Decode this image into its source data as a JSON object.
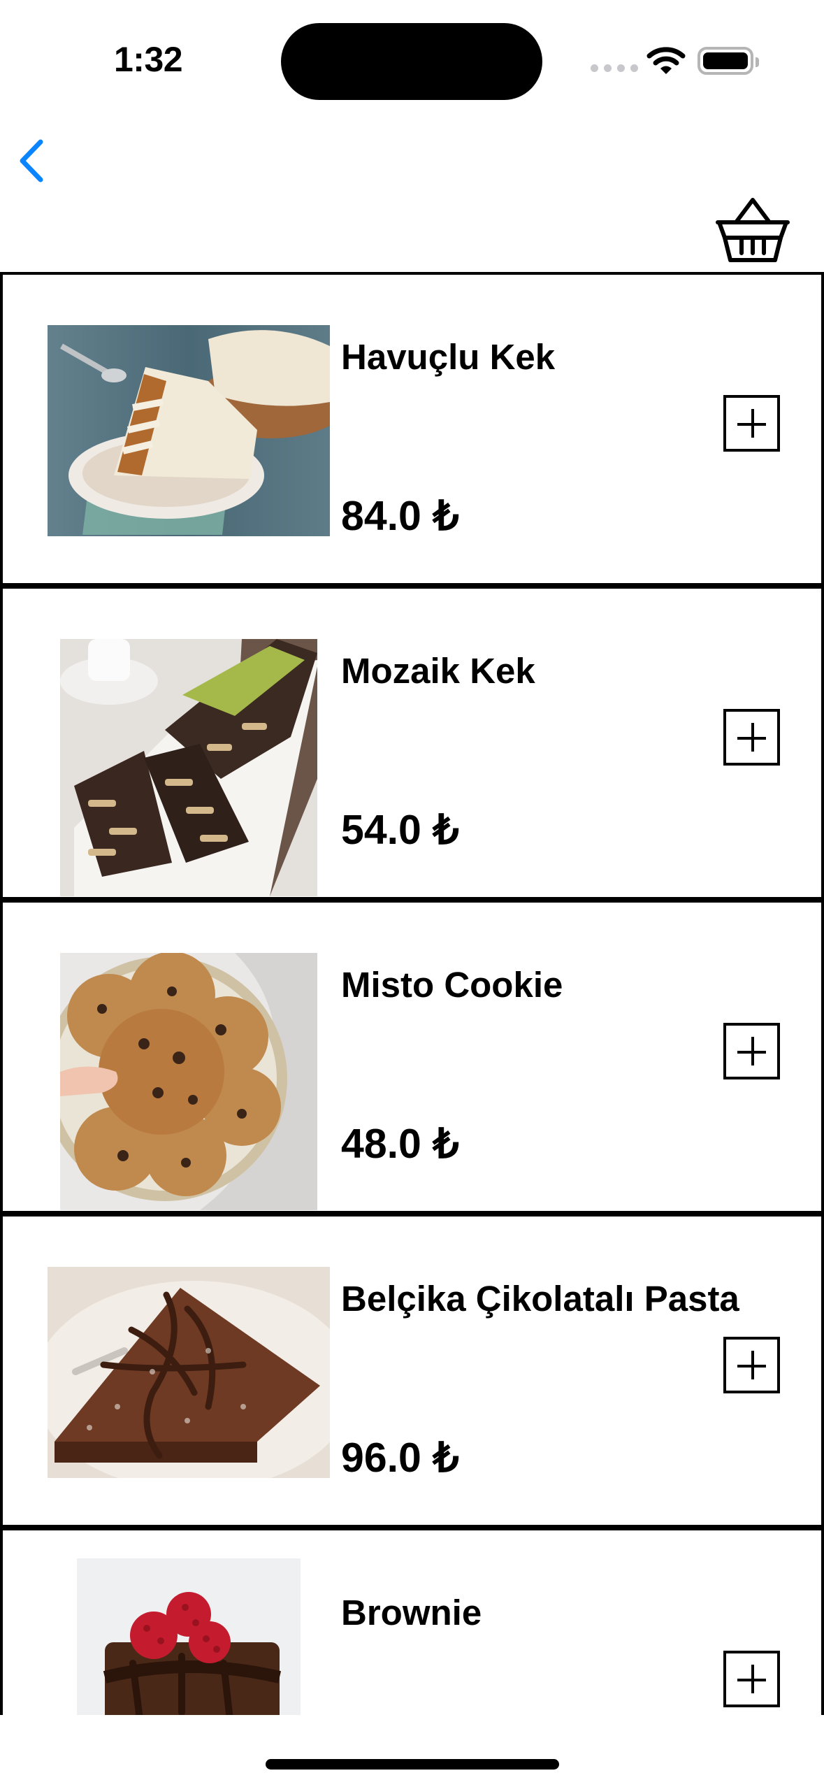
{
  "status_bar": {
    "time": "1:32"
  },
  "nav": {
    "back_icon": "chevron-left-icon",
    "basket_icon": "basket-icon",
    "accent_color": "#0a84ff"
  },
  "products": [
    {
      "name": "Havuçlu Kek",
      "price": "84.0 ₺",
      "image": "carrot-cake"
    },
    {
      "name": "Mozaik Kek",
      "price": "54.0 ₺",
      "image": "mosaic-cake"
    },
    {
      "name": "Misto Cookie",
      "price": "48.0 ₺",
      "image": "chocolate-chip-cookies"
    },
    {
      "name": "Belçika Çikolatalı Pasta",
      "price": "96.0 ₺",
      "image": "belgian-chocolate-cake"
    },
    {
      "name": "Brownie",
      "price": "",
      "image": "brownie-raspberries"
    }
  ]
}
